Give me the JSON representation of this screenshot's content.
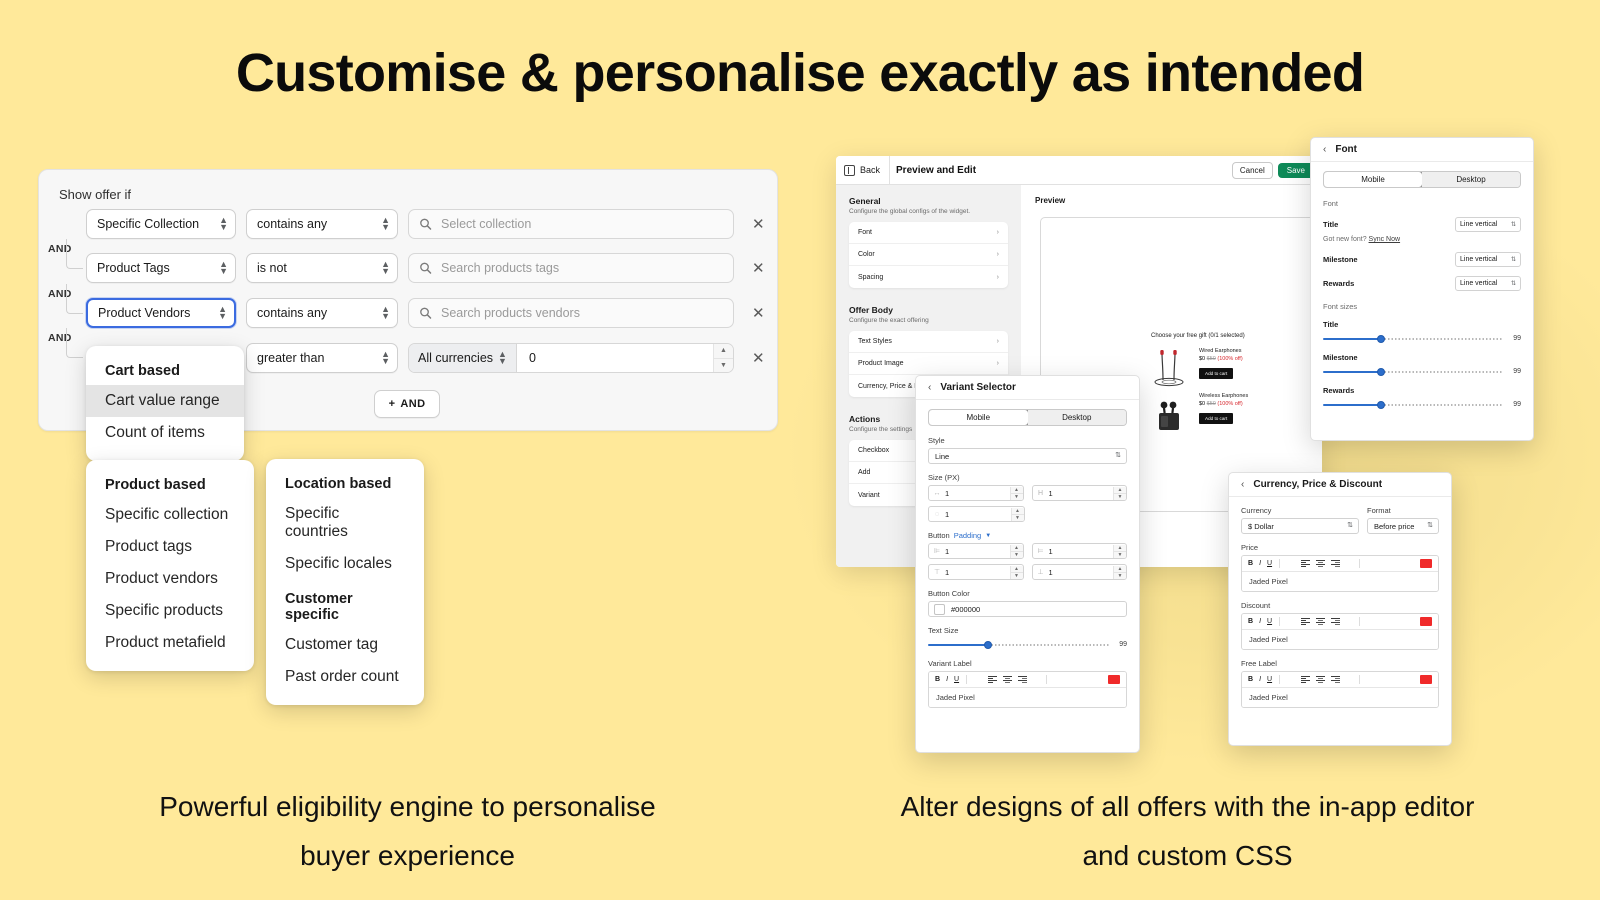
{
  "headline": "Customise & personalise exactly as intended",
  "captions": {
    "left": "Powerful eligibility engine to personalise buyer experience",
    "right": "Alter designs of all offers with the in-app editor and custom CSS"
  },
  "eligibility": {
    "title": "Show offer if",
    "and_label": "AND",
    "add_button": "AND",
    "rows": [
      {
        "field": "Specific Collection",
        "operator": "contains any",
        "value_placeholder": "Select collection"
      },
      {
        "field": "Product Tags",
        "operator": "is not",
        "value_placeholder": "Search products tags"
      },
      {
        "field": "Product Vendors",
        "operator": "contains any",
        "value_placeholder": "Search products vendors"
      },
      {
        "field": "",
        "operator": "greater than",
        "currency": "All currencies",
        "value": "0"
      }
    ]
  },
  "menus": {
    "cart": {
      "group": "Cart based",
      "items": [
        "Cart value range",
        "Count of items"
      ],
      "highlighted": "Cart value range"
    },
    "product": {
      "group": "Product based",
      "items": [
        "Specific collection",
        "Product tags",
        "Product vendors",
        "Specific products",
        "Product metafield"
      ]
    },
    "location": {
      "group": "Location based",
      "items": [
        "Specific countries",
        "Specific locales"
      ]
    },
    "customer": {
      "group": "Customer specific",
      "items": [
        "Customer tag",
        "Past order count"
      ]
    }
  },
  "editor": {
    "back_label": "Back",
    "title": "Preview and Edit",
    "cancel_label": "Cancel",
    "save_label": "Save",
    "sections": [
      {
        "heading": "General",
        "subheading": "Configure the global configs of the widget.",
        "rows": [
          "Font",
          "Color",
          "Spacing"
        ]
      },
      {
        "heading": "Offer Body",
        "subheading": "Configure the exact offering",
        "rows": [
          "Text Styles",
          "Product Image",
          "Currency, Price & Discount"
        ]
      },
      {
        "heading": "Actions",
        "subheading": "Configure the settings",
        "rows": [
          "Checkbox",
          "Add",
          "Variant"
        ]
      }
    ],
    "preview_label": "Preview",
    "widget": {
      "title": "Choose your free gift (0/1 selected)",
      "items": [
        {
          "name": "Wired Earphones",
          "price": "$0",
          "was": "$50",
          "off": "(100% off)",
          "cta": "Add to cart"
        },
        {
          "name": "Wireless Earphones",
          "price": "$0",
          "was": "$50",
          "off": "(100% off)",
          "cta": "Add to cart"
        }
      ]
    }
  },
  "variant_panel": {
    "title": "Variant Selector",
    "tabs": [
      "Mobile",
      "Desktop"
    ],
    "active_tab": "Mobile",
    "style_label": "Style",
    "style_value": "Line",
    "size_label": "Size (PX)",
    "size_w": "1",
    "size_h": "1",
    "size_r": "1",
    "button_label": "Button",
    "button_link": "Padding",
    "pad_left": "1",
    "pad_right": "1",
    "pad_top": "1",
    "pad_bottom": "1",
    "button_color_label": "Button Color",
    "button_color_value": "#000000",
    "text_size_label": "Text Size",
    "text_size_value": "99",
    "variant_label_label": "Variant Label",
    "variant_label_value": "Jaded Pixel"
  },
  "font_panel": {
    "title": "Font",
    "tabs": [
      "Mobile",
      "Desktop"
    ],
    "active_tab": "Mobile",
    "font_group": "Font",
    "rows": [
      {
        "name": "Title",
        "value": "Line vertical"
      },
      {
        "name": "Milestone",
        "value": "Line vertical"
      },
      {
        "name": "Rewards",
        "value": "Line vertical"
      }
    ],
    "sync_prefix": "Got new font?",
    "sync_link": "Sync Now",
    "sizes_group": "Font sizes",
    "sizes": [
      {
        "name": "Title",
        "value": "99"
      },
      {
        "name": "Milestone",
        "value": "99"
      },
      {
        "name": "Rewards",
        "value": "99"
      }
    ]
  },
  "currency_panel": {
    "title": "Currency, Price & Discount",
    "currency_label": "Currency",
    "currency_value": "$ Dollar",
    "format_label": "Format",
    "format_value": "Before price",
    "fields": [
      {
        "label": "Price",
        "value": "Jaded Pixel"
      },
      {
        "label": "Discount",
        "value": "Jaded Pixel"
      },
      {
        "label": "Free Label",
        "value": "Jaded Pixel"
      }
    ]
  },
  "colors": {
    "background": "#FFE99A",
    "accent_blue": "#2C6ECB",
    "save_green": "#0E8A58",
    "red_swatch": "#F02A2A"
  }
}
